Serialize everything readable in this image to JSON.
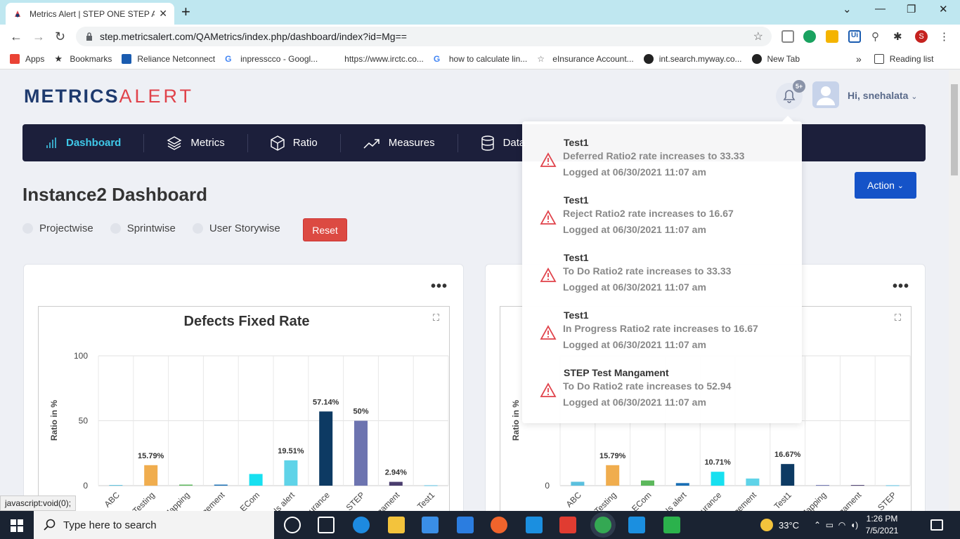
{
  "browser": {
    "tab_title": "Metrics Alert | STEP ONE STEP AH",
    "url": "step.metricsalert.com/QAMetrics/index.php/dashboard/index?id=Mg==",
    "profile_initial": "S",
    "bookmarks": [
      {
        "label": "Apps",
        "color": "#ea4335"
      },
      {
        "label": "Bookmarks",
        "color": "#222222"
      },
      {
        "label": "Reliance Netconnect",
        "color": "#1a5cb0"
      },
      {
        "label": "inpresscco - Googl...",
        "color": "#4285f4"
      },
      {
        "label": "https://www.irctc.co...",
        "color": "#ffffff"
      },
      {
        "label": "how to calculate lin...",
        "color": "#4285f4"
      },
      {
        "label": "eInsurance Account...",
        "color": "#666666"
      },
      {
        "label": "int.search.myway.co...",
        "color": "#222222"
      },
      {
        "label": "New Tab",
        "color": "#222222"
      }
    ],
    "more_bookmarks": "»",
    "reading_list": "Reading list",
    "status_url": "javascript:void(0);"
  },
  "header": {
    "logo_part1": "METRICS",
    "logo_part2": "ALERT",
    "notification_badge": "5+",
    "greeting": "Hi, snehalata"
  },
  "nav": {
    "items": [
      {
        "label": "Dashboard",
        "icon": "bar-chart-icon"
      },
      {
        "label": "Metrics",
        "icon": "layers-icon"
      },
      {
        "label": "Ratio",
        "icon": "box-icon"
      },
      {
        "label": "Measures",
        "icon": "trending-up-icon"
      },
      {
        "label": "Data",
        "icon": "database-icon"
      }
    ]
  },
  "main": {
    "title": "Instance2 Dashboard",
    "filters": [
      "Projectwise",
      "Sprintwise",
      "User Storywise"
    ],
    "reset_label": "Reset",
    "action_label": "Action"
  },
  "notifications": [
    {
      "title": "Test1",
      "message": "Deferred Ratio2 rate increases to 33.33",
      "logged": "Logged at 06/30/2021 11:07 am"
    },
    {
      "title": "Test1",
      "message": "Reject Ratio2 rate increases to 16.67",
      "logged": "Logged at 06/30/2021 11:07 am"
    },
    {
      "title": "Test1",
      "message": "To Do Ratio2 rate increases to 33.33",
      "logged": "Logged at 06/30/2021 11:07 am"
    },
    {
      "title": "Test1",
      "message": "In Progress Ratio2 rate increases to 16.67",
      "logged": "Logged at 06/30/2021 11:07 am"
    },
    {
      "title": "STEP Test Mangament",
      "message": "To Do Ratio2 rate increases to 52.94",
      "logged": "Logged at 06/30/2021 11:07 am"
    }
  ],
  "chart_data": [
    {
      "type": "bar",
      "title": "Defects Fixed Rate",
      "ylabel": "Ratio in %",
      "ylim": [
        0,
        100
      ],
      "yticks": [
        0,
        50,
        100
      ],
      "categories": [
        "ABC",
        "Testing",
        "Mapping",
        "Management",
        "ECom",
        "Is alert",
        "Insurance",
        "STEP",
        "Mangament",
        "Test1"
      ],
      "values": [
        0.5,
        15.79,
        0.8,
        0.8,
        9,
        19.51,
        57.14,
        50,
        2.94,
        0.3
      ],
      "labels": [
        "",
        "15.79%",
        "",
        "",
        "",
        "19.51%",
        "57.14%",
        "50%",
        "2.94%",
        ""
      ],
      "colors": [
        "#5bc0de",
        "#f0ad4e",
        "#5cb85c",
        "#1a6fb5",
        "#17e0f0",
        "#5fd3e8",
        "#0d3a63",
        "#6d74b0",
        "#4a3d6e",
        "#5bc0de"
      ]
    },
    {
      "type": "bar",
      "title": "",
      "ylabel": "Ratio in %",
      "ylim": [
        0,
        100
      ],
      "yticks": [
        0
      ],
      "categories": [
        "ABC",
        "Testing",
        "ECom",
        "Is alert",
        "Insurance",
        "Management",
        "Test1",
        "Mapping",
        "Mangament",
        "STEP"
      ],
      "values": [
        3,
        15.79,
        4,
        2,
        10.71,
        5.5,
        16.67,
        0.5,
        0.5,
        0.3
      ],
      "labels": [
        "",
        "15.79%",
        "",
        "",
        "10.71%",
        "",
        "16.67%",
        "",
        "",
        ""
      ],
      "colors": [
        "#5bc0de",
        "#f0ad4e",
        "#5cb85c",
        "#1a6fb5",
        "#17e0f0",
        "#5fd3e8",
        "#0d3a63",
        "#6d74b0",
        "#4a3d6e",
        "#5bc0de"
      ]
    }
  ],
  "taskbar": {
    "search_placeholder": "Type here to search",
    "temperature": "33°C",
    "time": "1:26 PM",
    "date": "7/5/2021"
  }
}
